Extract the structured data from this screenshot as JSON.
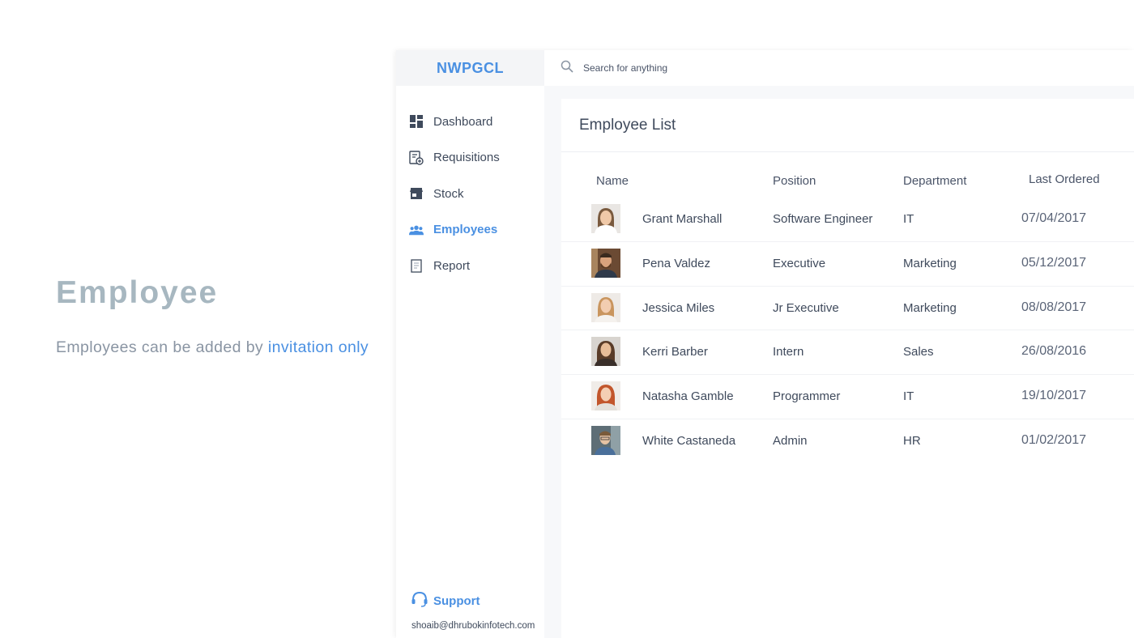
{
  "promo": {
    "title": "Employee",
    "subtitle_prefix": "Employees can be added by",
    "subtitle_highlight": "invitation only"
  },
  "app": {
    "brand": "NWPGCL",
    "search": {
      "placeholder": "Search for anything"
    },
    "nav": [
      {
        "label": "Dashboard",
        "icon": "dashboard-icon",
        "active": false
      },
      {
        "label": "Requisitions",
        "icon": "requisitions-icon",
        "active": false
      },
      {
        "label": "Stock",
        "icon": "store-icon",
        "active": false
      },
      {
        "label": "Employees",
        "icon": "people-icon",
        "active": true
      },
      {
        "label": "Report",
        "icon": "report-icon",
        "active": false
      }
    ],
    "support": {
      "label": "Support",
      "icon": "headset-icon",
      "email": "shoaib@dhrubokinfotech.com"
    },
    "accent_color": "#4a90e2"
  },
  "employee_list": {
    "title": "Employee List",
    "columns": [
      "Name",
      "Position",
      "Department",
      "Last Ordered"
    ],
    "rows": [
      {
        "name": "Grant Marshall",
        "position": "Software Engineer",
        "department": "IT",
        "last_ordered": "07/04/2017"
      },
      {
        "name": "Pena Valdez",
        "position": "Executive",
        "department": "Marketing",
        "last_ordered": "05/12/2017"
      },
      {
        "name": "Jessica Miles",
        "position": "Jr Executive",
        "department": "Marketing",
        "last_ordered": "08/08/2017"
      },
      {
        "name": "Kerri Barber",
        "position": "Intern",
        "department": "Sales",
        "last_ordered": "26/08/2016"
      },
      {
        "name": "Natasha Gamble",
        "position": "Programmer",
        "department": "IT",
        "last_ordered": "19/10/2017"
      },
      {
        "name": "White Castaneda",
        "position": "Admin",
        "department": "HR",
        "last_ordered": "01/02/2017"
      }
    ]
  }
}
